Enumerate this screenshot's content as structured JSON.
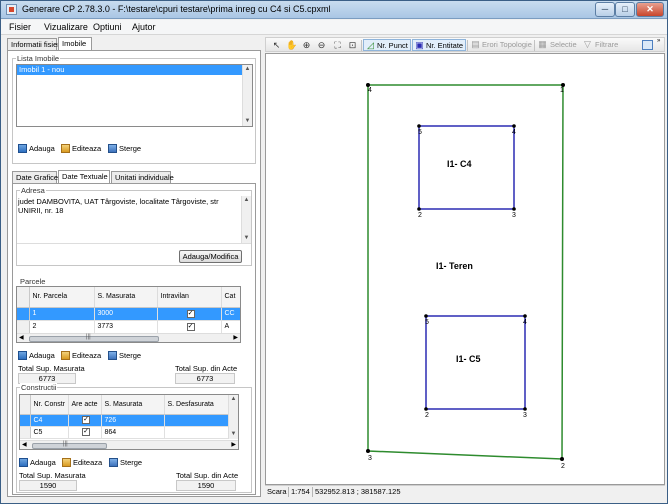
{
  "window": {
    "title": "Generare CP 2.78.3.0 - F:\\testare\\cpuri testare\\prima inreg cu C4 si C5.cpxml",
    "minimize": "─",
    "maximize": "□",
    "close": "✕"
  },
  "menu": [
    "Fisier",
    "Vizualizare",
    "Optiuni",
    "Ajutor"
  ],
  "top_tabs": [
    "Informatii fisier",
    "Imobile"
  ],
  "imobile": {
    "group_label": "Lista Imobile",
    "items": [
      "Imobil 1 - nou"
    ],
    "actions": [
      "Adauga",
      "Editeaza",
      "Sterge"
    ]
  },
  "inner_tabs": [
    "Date Grafice",
    "Date Textuale",
    "Unitati individuale"
  ],
  "adresa": {
    "label": "Adresa",
    "text": "judet DAMBOVITA, UAT Târgoviste, localitate Târgoviste, str UNIRII, nr. 18",
    "button": "Adauga/Modifica"
  },
  "parcele": {
    "label": "Parcele",
    "columns": [
      "Nr. Parcela",
      "S. Masurata",
      "Intravilan",
      "Cat"
    ],
    "rows": [
      {
        "nr": "1",
        "suprafata": "3000",
        "intravilan": "✓",
        "cat": "CC"
      },
      {
        "nr": "2",
        "suprafata": "3773",
        "intravilan": "✓",
        "cat": "A"
      }
    ],
    "scroll_thumb": "|||",
    "actions": [
      "Adauga",
      "Editeaza",
      "Sterge"
    ],
    "total_masurata_label": "Total Sup. Masurata",
    "total_masurata": "6773",
    "total_acte_label": "Total Sup. din Acte",
    "total_acte": "6773"
  },
  "constructii": {
    "label": "Constructii",
    "columns": [
      "Nr. Constr",
      "Are acte",
      "S. Masurata",
      "S. Desfasurata"
    ],
    "rows": [
      {
        "nr": "C4",
        "acte": "✓",
        "suprafata": "726",
        "desfasurata": ""
      },
      {
        "nr": "C5",
        "acte": "✓",
        "suprafata": "864",
        "desfasurata": ""
      }
    ],
    "scroll_thumb": "|||",
    "actions": [
      "Adauga",
      "Editeaza",
      "Sterge"
    ],
    "total_masurata_label": "Total Sup. Masurata",
    "total_masurata": "1590",
    "total_acte_label": "Total Sup. din Acte",
    "total_acte": "1590"
  },
  "toolbar": {
    "nr_punct": "Nr. Punct",
    "nr_entitate": "Nr. Entitate",
    "erori_topologie": "Erori Topologie",
    "selectie": "Selectie",
    "filtrare": "Filtrare"
  },
  "drawing": {
    "teren_label": "I1- Teren",
    "c4_label": "I1- C4",
    "c5_label": "I1- C5",
    "teren_vertices": [
      "4",
      "1",
      "2",
      "3"
    ],
    "c4_vertices": [
      "5",
      "4",
      "3",
      "2"
    ],
    "c5_vertices": [
      "5",
      "4",
      "3",
      "2"
    ],
    "colors": {
      "teren": "#2e8b2e",
      "constructie": "#2b2bb3"
    }
  },
  "status": {
    "scara_label": "Scara",
    "scara_value": "1:754",
    "coordinates": "532952.813 ; 381587.125"
  }
}
